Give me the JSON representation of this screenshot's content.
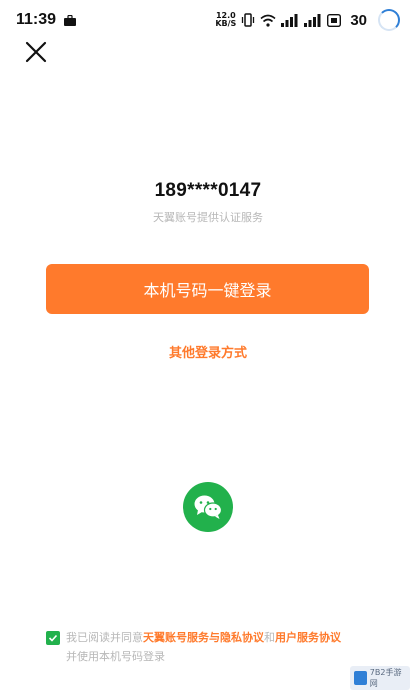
{
  "status_bar": {
    "time": "11:39",
    "speed_value": "12.0",
    "speed_unit": "KB/S",
    "battery": "30"
  },
  "login": {
    "phone_masked": "189****0147",
    "auth_note": "天翼账号提供认证服务",
    "one_click_label": "本机号码一键登录",
    "other_methods_label": "其他登录方式"
  },
  "agreement": {
    "prefix": "我已阅读并同意",
    "link_1": "天翼账号服务与隐私协议",
    "conjunction": "和",
    "link_2": "用户服务协议",
    "suffix": "并使用本机号码登录"
  },
  "icons": {
    "close": "close-icon",
    "wechat": "wechat-icon",
    "check": "check-icon"
  },
  "colors": {
    "accent": "#ff7a2c",
    "wechat_green": "#22b14c",
    "muted_text": "#b7b7b7"
  },
  "watermark": {
    "text": "7B2手游网"
  }
}
